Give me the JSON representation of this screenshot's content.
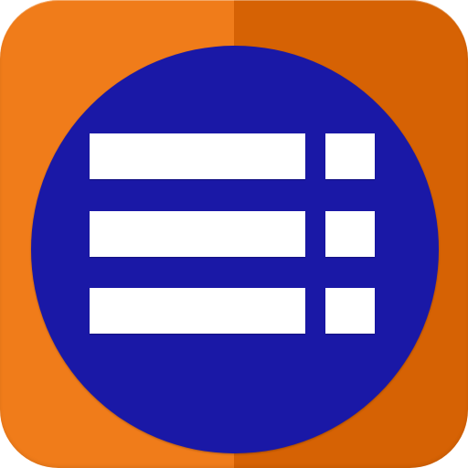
{
  "icon": {
    "name": "list-icon",
    "colors": {
      "background_left": "#F07C1A",
      "background_right": "#D66204",
      "circle": "#1A18A6",
      "bars": "#FFFFFF"
    },
    "rows": 3
  }
}
